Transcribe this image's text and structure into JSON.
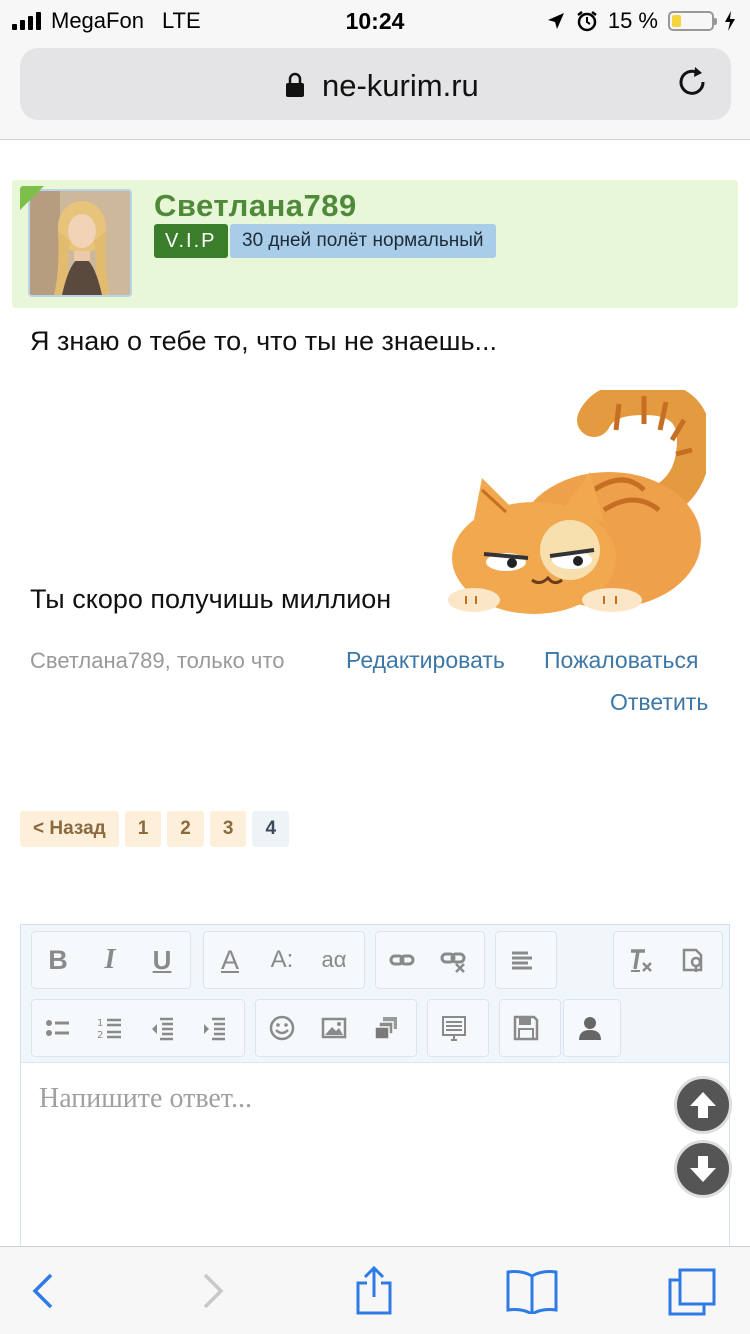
{
  "status_bar": {
    "carrier": "MegaFon",
    "network": "LTE",
    "time": "10:24",
    "battery_percent": "15 %",
    "battery_level": 0.15,
    "icons": [
      "signal-icon",
      "location-icon",
      "alarm-icon",
      "battery-icon",
      "charging-icon"
    ]
  },
  "browser": {
    "url": "ne-kurim.ru",
    "icons": [
      "lock-icon",
      "reload-icon"
    ]
  },
  "post": {
    "username": "Светлана789",
    "badge_vip": "V.I.P",
    "badge_status": "30 дней полёт нормальный",
    "message_line1": "Я знаю о тебе то, что ты не знаешь...",
    "message_line2": "Ты скоро получишь миллион",
    "meta": "Светлана789, только что",
    "edit_link": "Редактировать",
    "report_link": "Пожаловаться",
    "reply_link": "Ответить"
  },
  "pagination": {
    "back": "< Назад",
    "pages": [
      "1",
      "2",
      "3",
      "4"
    ],
    "current": "4"
  },
  "editor": {
    "placeholder": "Напишите ответ...",
    "toolbar_row1": [
      "bold",
      "italic",
      "underline",
      "font-color",
      "font-size",
      "subscript-case",
      "link",
      "unlink",
      "align",
      "remove-format",
      "paste-word"
    ],
    "toolbar_row2": [
      "bullet-list",
      "numbered-list",
      "outdent",
      "indent",
      "smiley",
      "image",
      "media",
      "template",
      "save",
      "user"
    ],
    "bold_label": "B",
    "italic_label": "I",
    "underline_label": "U",
    "font_color_label": "A",
    "font_size_label": "A:",
    "case_label": "aα"
  },
  "bottom_bar": {
    "icons": [
      "back-icon",
      "forward-icon",
      "share-icon",
      "bookmarks-icon",
      "tabs-icon"
    ]
  },
  "colors": {
    "accent_link": "#3d77a6",
    "username": "#4f8a3a",
    "vip_badge": "#3a7d2a",
    "status_badge": "#a9cde8",
    "post_header_bg": "#e8f7d8"
  }
}
